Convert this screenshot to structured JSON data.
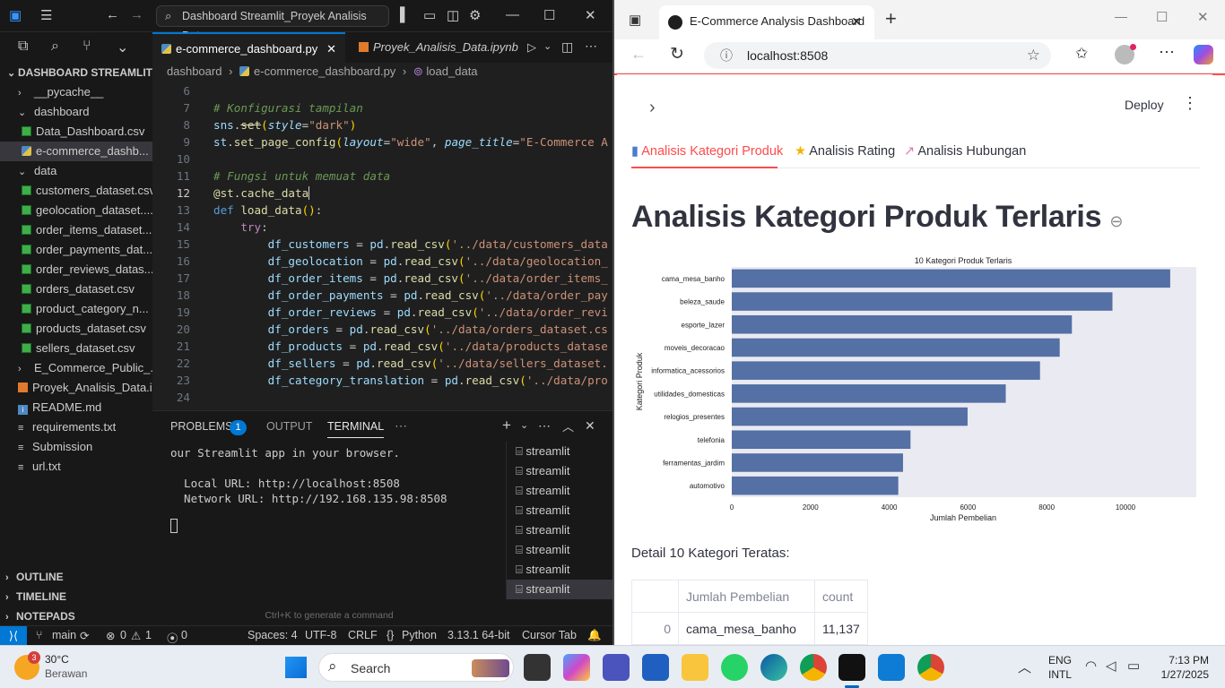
{
  "vscode": {
    "search_box": "Dashboard Streamlit_Proyek Analisis Data",
    "explorer_root": "DASHBOARD STREAMLIT_...",
    "tree": [
      {
        "label": "__pycache__",
        "type": "folder-closed",
        "indent": 1
      },
      {
        "label": "dashboard",
        "type": "folder-open",
        "indent": 1
      },
      {
        "label": "Data_Dashboard.csv",
        "type": "csv",
        "indent": 2
      },
      {
        "label": "e-commerce_dashb...",
        "type": "py",
        "indent": 2,
        "selected": true
      },
      {
        "label": "data",
        "type": "folder-open",
        "indent": 1
      },
      {
        "label": "customers_dataset.csv",
        "type": "csv",
        "indent": 2
      },
      {
        "label": "geolocation_dataset....",
        "type": "csv",
        "indent": 2
      },
      {
        "label": "order_items_dataset....",
        "type": "csv",
        "indent": 2
      },
      {
        "label": "order_payments_dat...",
        "type": "csv",
        "indent": 2
      },
      {
        "label": "order_reviews_datas...",
        "type": "csv",
        "indent": 2
      },
      {
        "label": "orders_dataset.csv",
        "type": "csv",
        "indent": 2
      },
      {
        "label": "product_category_n...",
        "type": "csv",
        "indent": 2
      },
      {
        "label": "products_dataset.csv",
        "type": "csv",
        "indent": 2
      },
      {
        "label": "sellers_dataset.csv",
        "type": "csv",
        "indent": 2
      },
      {
        "label": "E_Commerce_Public_...",
        "type": "folder-closed",
        "indent": 1
      },
      {
        "label": "Proyek_Analisis_Data.i...",
        "type": "ipynb",
        "indent": 1
      },
      {
        "label": "README.md",
        "type": "md",
        "indent": 1
      },
      {
        "label": "requirements.txt",
        "type": "txt",
        "indent": 1
      },
      {
        "label": "Submission",
        "type": "txt",
        "indent": 1
      },
      {
        "label": "url.txt",
        "type": "txt",
        "indent": 1
      }
    ],
    "outline": "OUTLINE",
    "timeline": "TIMELINE",
    "notepads": "NOTEPADS",
    "tab_active": "e-commerce_dashboard.py",
    "tab_other": "Proyek_Analisis_Data.ipynb",
    "crumb_1": "dashboard",
    "crumb_2": "e-commerce_dashboard.py",
    "crumb_3": "load_data",
    "line_numbers": [
      "6",
      "7",
      "8",
      "9",
      "10",
      "11",
      "12",
      "13",
      "14",
      "15",
      "16",
      "17",
      "18",
      "19",
      "20",
      "21",
      "22",
      "23",
      "24"
    ],
    "panel_problems": "PROBLEMS",
    "panel_problems_count": "1",
    "panel_output": "OUTPUT",
    "panel_terminal": "TERMINAL",
    "terminal_text": "our Streamlit app in your browser.\n\n  Local URL: http://localhost:8508\n  Network URL: http://192.168.135.98:8508",
    "terminal_hint": "Ctrl+K to generate a command",
    "terminal_list": [
      "streamlit",
      "streamlit",
      "streamlit",
      "streamlit",
      "streamlit",
      "streamlit",
      "streamlit",
      "streamlit"
    ],
    "status": {
      "branch": "main",
      "problems": "0",
      "warnings": "1",
      "ports": "0",
      "spaces": "Spaces: 4",
      "encoding": "UTF-8",
      "eol": "CRLF",
      "language": "Python",
      "interpreter": "3.13.1 64-bit",
      "cursor_tab": "Cursor Tab"
    }
  },
  "browser": {
    "tab_title": "E-Commerce Analysis Dashboard",
    "url": "localhost:8508",
    "deploy": "Deploy",
    "st_tabs": [
      "Analisis Kategori Produk",
      "Analisis Rating",
      "Analisis Hubungan"
    ],
    "heading": "Analisis Kategori Produk Terlaris",
    "subheader": "Detail 10 Kategori Teratas:",
    "table_headers": [
      "",
      "Jumlah Pembelian",
      "count"
    ],
    "table_rows": [
      [
        "0",
        "cama_mesa_banho",
        "11,137"
      ]
    ]
  },
  "chart_data": {
    "type": "bar",
    "orientation": "horizontal",
    "title": "10 Kategori Produk Terlaris",
    "xlabel": "Jumlah Pembelian",
    "ylabel": "Kategori Produk",
    "categories": [
      "cama_mesa_banho",
      "beleza_saude",
      "esporte_lazer",
      "moveis_decoracao",
      "informatica_acessorios",
      "utilidades_domesticas",
      "relogios_presentes",
      "telefonia",
      "ferramentas_jardim",
      "automotivo"
    ],
    "values": [
      11137,
      9670,
      8640,
      8330,
      7830,
      6960,
      5990,
      4540,
      4350,
      4230
    ],
    "xlim": [
      0,
      11800
    ],
    "xticks": [
      0,
      2000,
      4000,
      6000,
      8000,
      10000
    ],
    "bar_color": "#5470a4",
    "background": "#eaeaf2"
  },
  "taskbar": {
    "weather_temp": "30°C",
    "weather_desc": "Berawan",
    "weather_badge": "3",
    "search": "Search",
    "lang_1": "ENG",
    "lang_2": "INTL",
    "time": "7:13 PM",
    "date": "1/27/2025"
  }
}
